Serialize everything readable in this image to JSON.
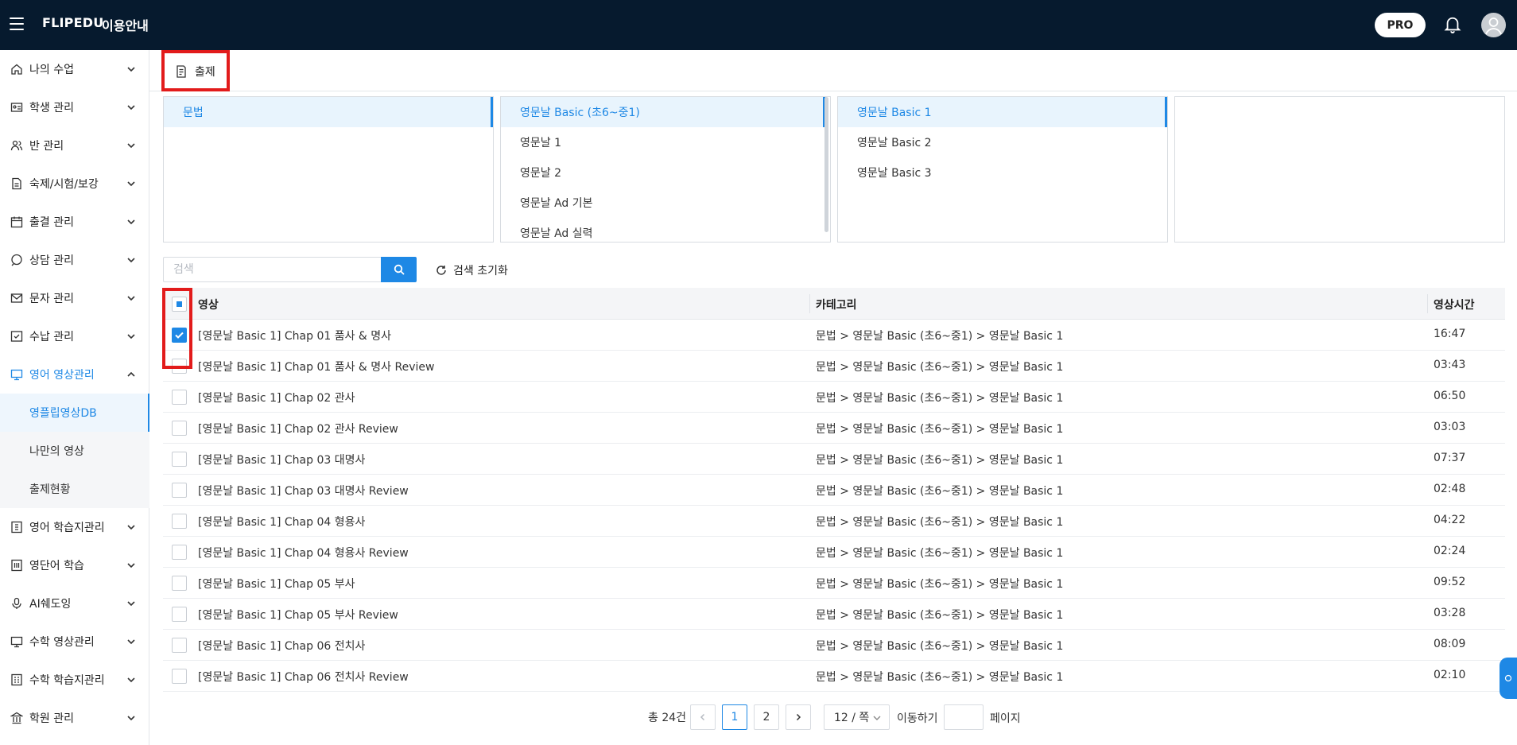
{
  "header": {
    "brand": "FLIPEDU",
    "guide": "이용안내",
    "pro": "PRO"
  },
  "sidebar": {
    "items": [
      {
        "label": "나의 수업",
        "icon": "home-icon"
      },
      {
        "label": "학생 관리",
        "icon": "id-card-icon"
      },
      {
        "label": "반 관리",
        "icon": "users-icon"
      },
      {
        "label": "숙제/시험/보강",
        "icon": "document-icon"
      },
      {
        "label": "출결 관리",
        "icon": "calendar-icon"
      },
      {
        "label": "상담 관리",
        "icon": "chat-icon"
      },
      {
        "label": "문자 관리",
        "icon": "mail-icon"
      },
      {
        "label": "수납 관리",
        "icon": "receipt-icon"
      },
      {
        "label": "영어 영상관리",
        "icon": "monitor-icon"
      },
      {
        "label": "영어 학습지관리",
        "icon": "book-icon"
      },
      {
        "label": "영단어 학습",
        "icon": "vocab-icon"
      },
      {
        "label": "AI쉐도잉",
        "icon": "microphone-icon"
      },
      {
        "label": "수학 영상관리",
        "icon": "monitor-icon"
      },
      {
        "label": "수학 학습지관리",
        "icon": "calculator-icon"
      },
      {
        "label": "학원 관리",
        "icon": "building-icon"
      }
    ],
    "subitems": [
      "영플립영상DB",
      "나만의 영상",
      "출제현황"
    ]
  },
  "tab": {
    "label": "출제"
  },
  "categories": {
    "col1": [
      "문법"
    ],
    "col2": [
      "영문날 Basic (초6~중1)",
      "영문날 1",
      "영문날 2",
      "영문날 Ad 기본",
      "영문날 Ad 실력"
    ],
    "col3": [
      "영문날 Basic 1",
      "영문날 Basic 2",
      "영문날 Basic 3"
    ]
  },
  "search": {
    "placeholder": "검색",
    "reset_label": "검색 초기화"
  },
  "table": {
    "headers": {
      "video": "영상",
      "category": "카테고리",
      "duration": "영상시간"
    },
    "rows": [
      {
        "title": "[영문날 Basic 1] Chap 01 품사 & 명사",
        "category": "문법 > 영문날 Basic (초6~중1) > 영문날 Basic 1",
        "duration": "16:47",
        "checked": true
      },
      {
        "title": "[영문날 Basic 1] Chap 01 품사 & 명사 Review",
        "category": "문법 > 영문날 Basic (초6~중1) > 영문날 Basic 1",
        "duration": "03:43",
        "checked": false
      },
      {
        "title": "[영문날 Basic 1] Chap 02 관사",
        "category": "문법 > 영문날 Basic (초6~중1) > 영문날 Basic 1",
        "duration": "06:50",
        "checked": false
      },
      {
        "title": "[영문날 Basic 1] Chap 02 관사 Review",
        "category": "문법 > 영문날 Basic (초6~중1) > 영문날 Basic 1",
        "duration": "03:03",
        "checked": false
      },
      {
        "title": "[영문날 Basic 1] Chap 03 대명사",
        "category": "문법 > 영문날 Basic (초6~중1) > 영문날 Basic 1",
        "duration": "07:37",
        "checked": false
      },
      {
        "title": "[영문날 Basic 1] Chap 03 대명사 Review",
        "category": "문법 > 영문날 Basic (초6~중1) > 영문날 Basic 1",
        "duration": "02:48",
        "checked": false
      },
      {
        "title": "[영문날 Basic 1] Chap 04 형용사",
        "category": "문법 > 영문날 Basic (초6~중1) > 영문날 Basic 1",
        "duration": "04:22",
        "checked": false
      },
      {
        "title": "[영문날 Basic 1] Chap 04 형용사 Review",
        "category": "문법 > 영문날 Basic (초6~중1) > 영문날 Basic 1",
        "duration": "02:24",
        "checked": false
      },
      {
        "title": "[영문날 Basic 1] Chap 05 부사",
        "category": "문법 > 영문날 Basic (초6~중1) > 영문날 Basic 1",
        "duration": "09:52",
        "checked": false
      },
      {
        "title": "[영문날 Basic 1] Chap 05 부사 Review",
        "category": "문법 > 영문날 Basic (초6~중1) > 영문날 Basic 1",
        "duration": "03:28",
        "checked": false
      },
      {
        "title": "[영문날 Basic 1] Chap 06 전치사",
        "category": "문법 > 영문날 Basic (초6~중1) > 영문날 Basic 1",
        "duration": "08:09",
        "checked": false
      },
      {
        "title": "[영문날 Basic 1] Chap 06 전치사 Review",
        "category": "문법 > 영문날 Basic (초6~중1) > 영문날 Basic 1",
        "duration": "02:10",
        "checked": false
      }
    ]
  },
  "pagination": {
    "total": "총 24건",
    "pages": [
      "1",
      "2"
    ],
    "current": "1",
    "page_size": "12 / 쪽",
    "goto_label": "이동하기",
    "page_label": "페이지"
  },
  "colors": {
    "topbar": "#061a2e",
    "accent": "#1e88e5",
    "highlight": "#e21b1b"
  }
}
